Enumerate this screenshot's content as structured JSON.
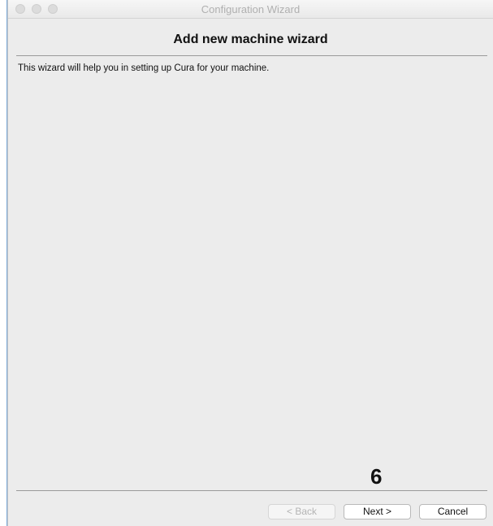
{
  "window": {
    "title": "Configuration Wizard"
  },
  "wizard": {
    "heading": "Add new machine wizard",
    "description": "This wizard will help you in setting up Cura for your machine.",
    "step_marker": "6"
  },
  "buttons": {
    "back_label": "< Back",
    "next_label": "Next >",
    "cancel_label": "Cancel",
    "back_enabled": false
  }
}
